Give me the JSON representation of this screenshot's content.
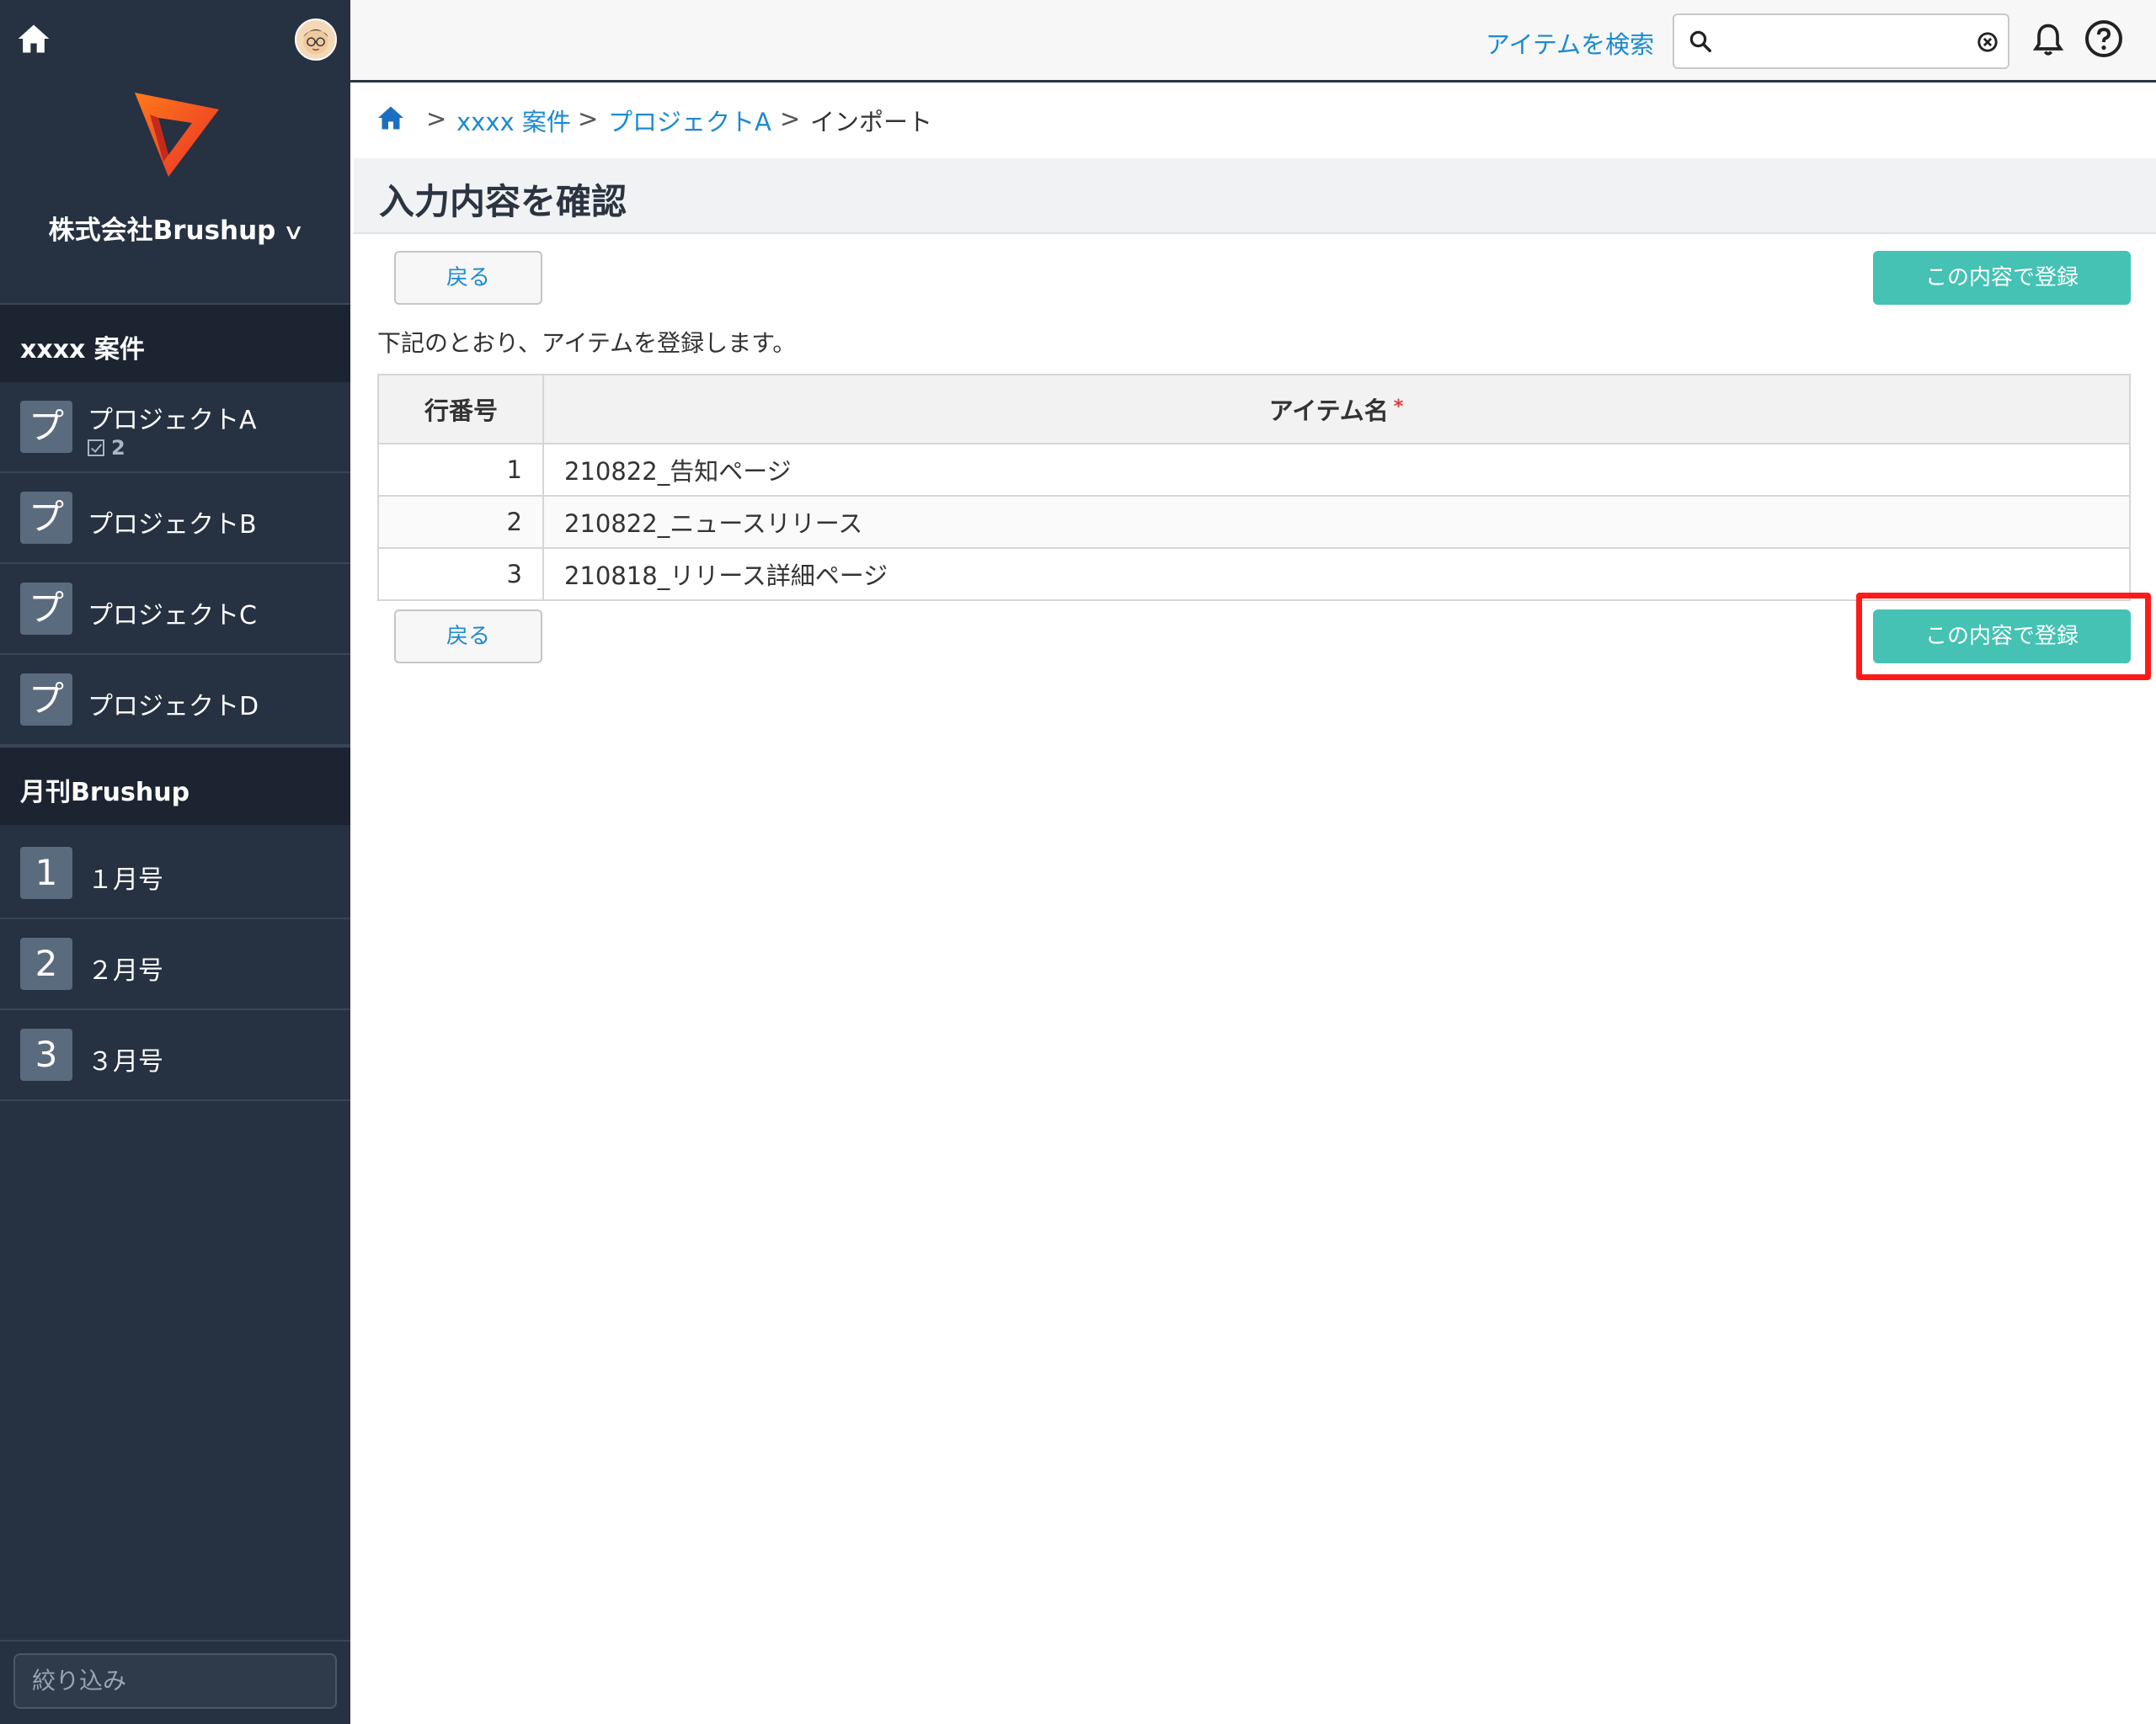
{
  "sidebar": {
    "company": "株式会社Brushup",
    "groups": [
      {
        "label": "xxxx 案件"
      },
      {
        "label": "月刊Brushup"
      }
    ],
    "projects": [
      {
        "tile": "プ",
        "label": "プロジェクトA",
        "count": "2"
      },
      {
        "tile": "プ",
        "label": "プロジェクトB"
      },
      {
        "tile": "プ",
        "label": "プロジェクトC"
      },
      {
        "tile": "プ",
        "label": "プロジェクトD"
      }
    ],
    "issues": [
      {
        "tile": "1",
        "label": "１月号"
      },
      {
        "tile": "2",
        "label": "２月号"
      },
      {
        "tile": "3",
        "label": "３月号"
      }
    ],
    "filter_placeholder": "絞り込み"
  },
  "topbar": {
    "search_link": "アイテムを検索",
    "search_value": "",
    "icons": [
      "home-icon",
      "avatar",
      "search-icon",
      "clear-icon",
      "bell-icon",
      "help-icon"
    ]
  },
  "breadcrumb": {
    "sep": ">",
    "items": [
      "xxxx 案件",
      "プロジェクトA"
    ],
    "current": "インポート"
  },
  "page": {
    "title": "入力内容を確認",
    "back_label": "戻る",
    "register_label": "この内容で登録",
    "description": "下記のとおり、アイテムを登録します。"
  },
  "table": {
    "headers": [
      "行番号",
      "アイテム名"
    ],
    "required_mark": "*",
    "rows": [
      {
        "no": "1",
        "name": "210822_告知ページ"
      },
      {
        "no": "2",
        "name": "210822_ニュースリリース"
      },
      {
        "no": "3",
        "name": "210818_リリース詳細ページ"
      }
    ]
  },
  "colors": {
    "sidebar": "#263141",
    "accent": "#45c2b3",
    "link": "#1c8ad0",
    "highlight": "#ff1a1a"
  }
}
